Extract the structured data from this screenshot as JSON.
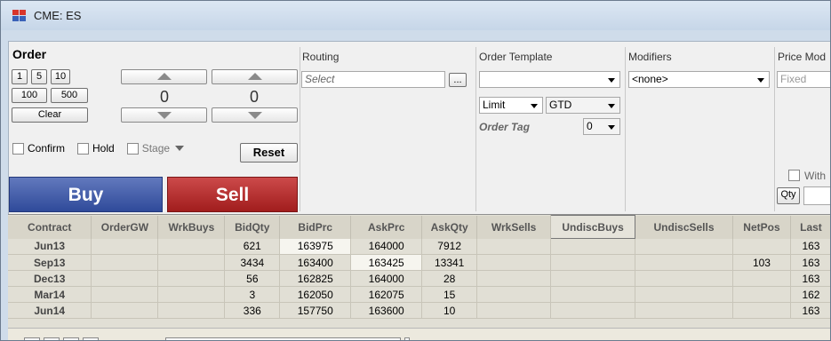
{
  "window": {
    "title": "CME: ES"
  },
  "order": {
    "title": "Order",
    "qty_buttons": [
      "1",
      "5",
      "10",
      "100",
      "500"
    ],
    "clear_label": "Clear",
    "price_value": "0",
    "qty_value": "0",
    "confirm_label": "Confirm",
    "hold_label": "Hold",
    "stage_label": "Stage",
    "reset_label": "Reset",
    "buy_label": "Buy",
    "sell_label": "Sell"
  },
  "routing": {
    "label": "Routing",
    "placeholder": "Select",
    "browse_label": "..."
  },
  "template": {
    "label": "Order Template",
    "value": "",
    "order_type": "Limit",
    "tif": "GTD",
    "order_tag_label": "Order Tag",
    "order_tag_value": "0"
  },
  "modifiers": {
    "label": "Modifiers",
    "value": "<none>"
  },
  "price_mode": {
    "label": "Price Mod",
    "value": "Fixed",
    "with_label": "With",
    "qty_label": "Qty"
  },
  "grid": {
    "columns": [
      "Contract",
      "OrderGW",
      "WrkBuys",
      "BidQty",
      "BidPrc",
      "AskPrc",
      "AskQty",
      "WrkSells",
      "UndiscBuys",
      "UndiscSells",
      "NetPos",
      "Last"
    ],
    "rows": [
      [
        "Jun13",
        "",
        "",
        "621",
        "163975",
        "164000",
        "7912",
        "",
        "",
        "",
        "",
        "163"
      ],
      [
        "Sep13",
        "",
        "",
        "3434",
        "163400",
        "163425",
        "13341",
        "",
        "",
        "",
        "103",
        "163"
      ],
      [
        "Dec13",
        "",
        "",
        "56",
        "162825",
        "164000",
        "28",
        "",
        "",
        "",
        "",
        "163"
      ],
      [
        "Mar14",
        "",
        "",
        "3",
        "162050",
        "162075",
        "15",
        "",
        "",
        "",
        "",
        "162"
      ],
      [
        "Jun14",
        "",
        "",
        "336",
        "157750",
        "163600",
        "10",
        "",
        "",
        "",
        "",
        "163"
      ]
    ]
  },
  "colors": {
    "buy": "#2f4a9a",
    "sell": "#a11d1d",
    "title_bar": "#cfdcea",
    "grid_bg": "#e1dfd5"
  }
}
